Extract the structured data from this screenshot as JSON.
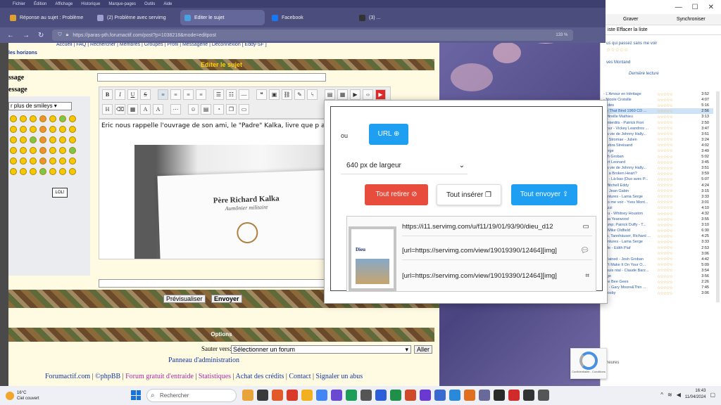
{
  "browser": {
    "menu": [
      "Fichier",
      "Édition",
      "Affichage",
      "Historique",
      "Marque-pages",
      "Outils",
      "Aide"
    ],
    "tabs": [
      {
        "label": "Réponse au sujet : Problème",
        "color": "#e0a030"
      },
      {
        "label": "(2) Problème avec servimg",
        "color": "#a0a0d0"
      },
      {
        "label": "Editer le sujet",
        "color": "#4aa0e0",
        "active": true
      },
      {
        "label": "Facebook",
        "color": "#1877f2"
      },
      {
        "label": "(3) ...",
        "color": "#333333"
      }
    ],
    "url": "https://paras-pth.forumactif.com/post?p=1038218&mode=editpost",
    "zoom": "133 %"
  },
  "forum": {
    "nav_links": "Accueil | FAQ | Rechercher | Membres | Groupes | Profil | Messagerie | Déconnexion [ Eddy-SF ]",
    "horizons": "les horizons",
    "edit_title": "Editer le sujet",
    "label_subject": "ssage",
    "label_message": "essage",
    "smiley_select": "r plus de smileys",
    "editor_text": "Eric nous rappelle l'ouvrage de son ami, le \"Padre\" Kalka, livre que p apprécié, comme écrit plus haut.",
    "card_name": "Père Richard Kalka",
    "card_sub": "Aumônier militaire",
    "lol": "LOL!",
    "preview_btn": "Prévisualiser",
    "send_btn": "Envoyer",
    "options_title": "Options",
    "jump_label": "Sauter vers:",
    "jump_select": "Sélectionner un forum",
    "jump_go": "Aller",
    "admin_link": "Panneau d'administration",
    "footer": {
      "l1": "Forumactif.com",
      "l2": "©phpBB",
      "l3": "Forum gratuit d'entraide",
      "l4": "Statistiques",
      "l5": "Achat des crédits",
      "l6": "Contact",
      "l7": "Signaler un abus"
    }
  },
  "popup": {
    "ou": "ou",
    "url_btn": "URL",
    "width_select": "640 px de largeur",
    "retirer": "Tout retirer",
    "inserer": "Tout insérer",
    "envoyer": "Tout envoyer",
    "book_title": "Dieu",
    "lines": [
      "https://i11.servimg.com/u/f11/19/01/93/90/dieu_d12",
      "[url=https://servimg.com/view/19019390/12464][img]",
      "[url=https://servimg.com/view/19019390/12464][img]"
    ]
  },
  "recaptcha": {
    "text": "Confidentialité - Conditions"
  },
  "rightwin": {
    "controls": [
      "—",
      "☐",
      "✕"
    ],
    "toolbar": [
      "Graver",
      "Synchroniser"
    ],
    "sub": "iste   Effacer la liste",
    "info": "us qui passez sans me voir",
    "artist": "ves Montand",
    "head": "Dernière lecture",
    "rows": [
      {
        "t": "- L'Amour en Héritage",
        "d": "3:52"
      },
      {
        "t": "- Nicole Croisille",
        "d": "4:07"
      },
      {
        "t": "dades",
        "d": "5:16"
      },
      {
        "t": "ies That Bind 1960 CD ...",
        "d": "2:56",
        "hl": true
      },
      {
        "t": "- Mireille Mathieu",
        "d": "3:13"
      },
      {
        "t": "s interdits - Patrick Fiori",
        "d": "2:50"
      },
      {
        "t": "mour - Vickey Leandros ...",
        "d": "3:47"
      },
      {
        "t": "ma vie de Johnny Hally...",
        "d": "3:51"
      },
      {
        "t": "de Stromae - Julien",
        "d": "3:24"
      },
      {
        "t": "Barbra Streisand",
        "d": "4:02"
      },
      {
        "t": "Serge",
        "d": "3:49"
      },
      {
        "t": "osh Groban",
        "d": "5:02"
      },
      {
        "t": "bert Leonard",
        "d": "3:45"
      },
      {
        "t": "ma vie de Johnny Hally...",
        "d": "3:51"
      },
      {
        "t": "nd a Broken Heart?",
        "d": "3:59"
      },
      {
        "t": "15 - Là-bas (Duo avec P...",
        "d": "5:07"
      },
      {
        "t": "- Mitchell Eddy",
        "d": "4:24"
      },
      {
        "t": "a - Jean Gabin",
        "d": "3:15"
      },
      {
        "t": "ventures - Lama Serge",
        "d": "3:33"
      },
      {
        "t": "ans me voir - Yves Mont...",
        "d": "3:01"
      },
      {
        "t": "Tozzi",
        "d": "4:10"
      },
      {
        "t": "You - Whitney Houston",
        "d": "4:32"
      },
      {
        "t": "isha Yearwood",
        "d": "3:55"
      },
      {
        "t": "Bamp; Patrick Duffy - T...",
        "d": "3:10"
      },
      {
        "t": "l - Mike Oldfield",
        "d": "6:30"
      },
      {
        "t": "ms, Tannhäuser, Richard ...",
        "d": "4:25"
      },
      {
        "t": "ventures - Lama Serge",
        "d": "3:33"
      },
      {
        "t": "sale - Edith Piaf",
        "d": "2:53"
      },
      {
        "t": "",
        "d": "3:06"
      },
      {
        "t": "t Rained - Josh Groban",
        "d": "4:42"
      },
      {
        "t": "an't Make It On Your O...",
        "d": "5:09"
      },
      {
        "t": "e suis ntal - Claude Barz...",
        "d": "3:54"
      },
      {
        "t": "erge",
        "d": "3:56"
      },
      {
        "t": "The Bee Gees",
        "d": "2:26"
      },
      {
        "t": "ou - Gary Moore&Thin ...",
        "d": "7:45"
      },
      {
        "t": "Crosby",
        "d": "3:06"
      }
    ],
    "bottom": "heures"
  },
  "taskbar": {
    "temp": "16°C",
    "weather": "Ciel couvert",
    "search": "Rechercher",
    "time": "16:43",
    "date": "11/04/2024",
    "apps": [
      "#e8a33a",
      "#3a3a3a",
      "#e25a2a",
      "#d93a2a",
      "#f0b020",
      "#4285f4",
      "#6a4ad0",
      "#1c9e5a",
      "#555555",
      "#2b5ed8",
      "#1f8f4a",
      "#d04a2a",
      "#6a3ad0",
      "#3a6ad0",
      "#2a8ad8",
      "#e07020",
      "#6a6a9a",
      "#2a2a2a",
      "#d02a2a",
      "#333333",
      "#555555"
    ]
  }
}
